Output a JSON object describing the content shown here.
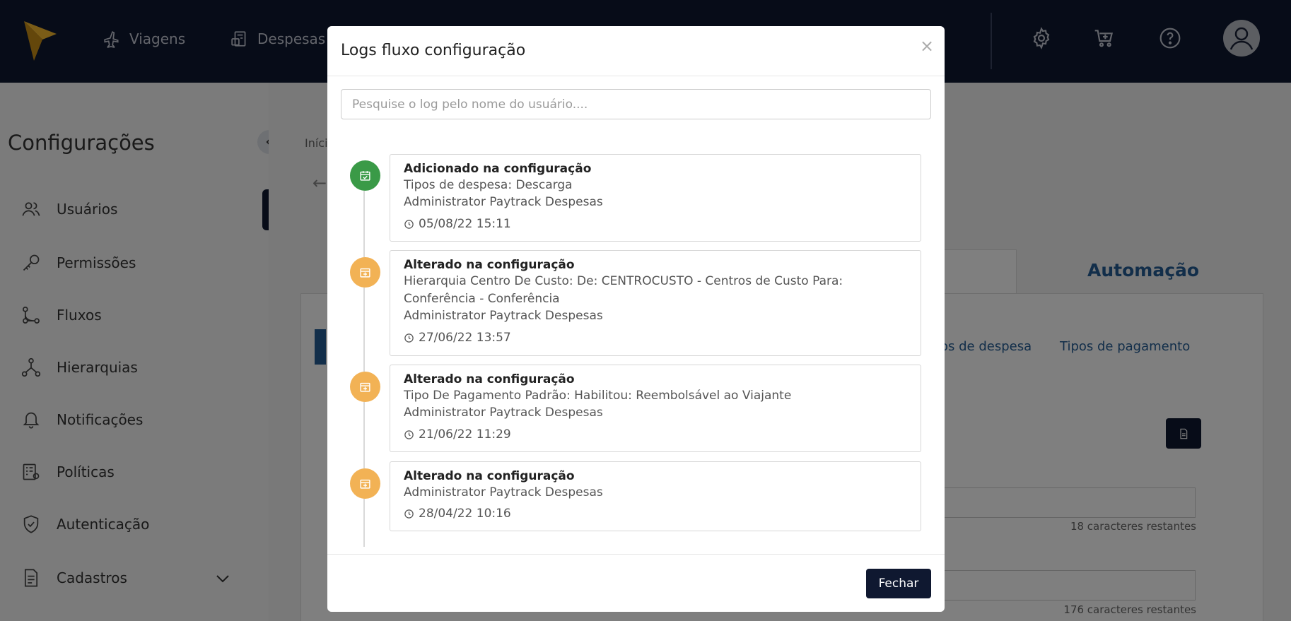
{
  "topbar": {
    "nav": [
      {
        "label": "Viagens",
        "icon": "airplane-icon"
      },
      {
        "label": "Despesas",
        "icon": "receipt-icon"
      }
    ],
    "icons": [
      "gear-icon",
      "cart-icon",
      "help-icon"
    ],
    "colors": {
      "background": "#0f1830",
      "logo": "#f5b82e"
    }
  },
  "sidebar": {
    "title": "Configurações",
    "items": [
      {
        "label": "Usuários",
        "icon": "users-icon"
      },
      {
        "label": "Permissões",
        "icon": "key-icon"
      },
      {
        "label": "Fluxos",
        "icon": "flow-icon"
      },
      {
        "label": "Hierarquias",
        "icon": "hierarchy-icon"
      },
      {
        "label": "Notificações",
        "icon": "bell-icon"
      },
      {
        "label": "Políticas",
        "icon": "policy-icon"
      },
      {
        "label": "Autenticação",
        "icon": "shield-icon"
      },
      {
        "label": "Cadastros",
        "icon": "document-icon"
      }
    ]
  },
  "main": {
    "breadcrumb": "Iníci",
    "tab_automation": "Automação",
    "link_despesa": "os de despesa",
    "link_pagamento": "Tipos de pagamento",
    "hint1": "18 caracteres restantes",
    "hint2": "176 caracteres restantes"
  },
  "modal": {
    "title": "Logs fluxo configuração",
    "close_symbol": "×",
    "search_placeholder": "Pesquise o log pelo nome do usuário....",
    "logs": [
      {
        "title": "Adicionado na configuração",
        "description": "Tipos de despesa: Descarga",
        "user": " Administrator Paytrack Despesas",
        "time": "05/08/22 15:11",
        "status": "added",
        "color": "#3a9a47"
      },
      {
        "title": "Alterado na configuração",
        "description": "Hierarquia Centro De Custo: De: CENTROCUSTO - Centros de Custo Para: Conferência - Conferência",
        "user": " Administrator Paytrack Despesas",
        "time": "27/06/22 13:57",
        "status": "changed",
        "color": "#f2b255"
      },
      {
        "title": "Alterado na configuração",
        "description": "Tipo De Pagamento Padrão: Habilitou: Reembolsável ao Viajante",
        "user": " Administrator Paytrack Despesas",
        "time": "21/06/22 11:29",
        "status": "changed",
        "color": "#f2b255"
      },
      {
        "title": "Alterado na configuração",
        "description": "",
        "user": " Administrator Paytrack Despesas",
        "time": "28/04/22 10:16",
        "status": "changed",
        "color": "#f2b255"
      }
    ],
    "close_button": "Fechar"
  }
}
